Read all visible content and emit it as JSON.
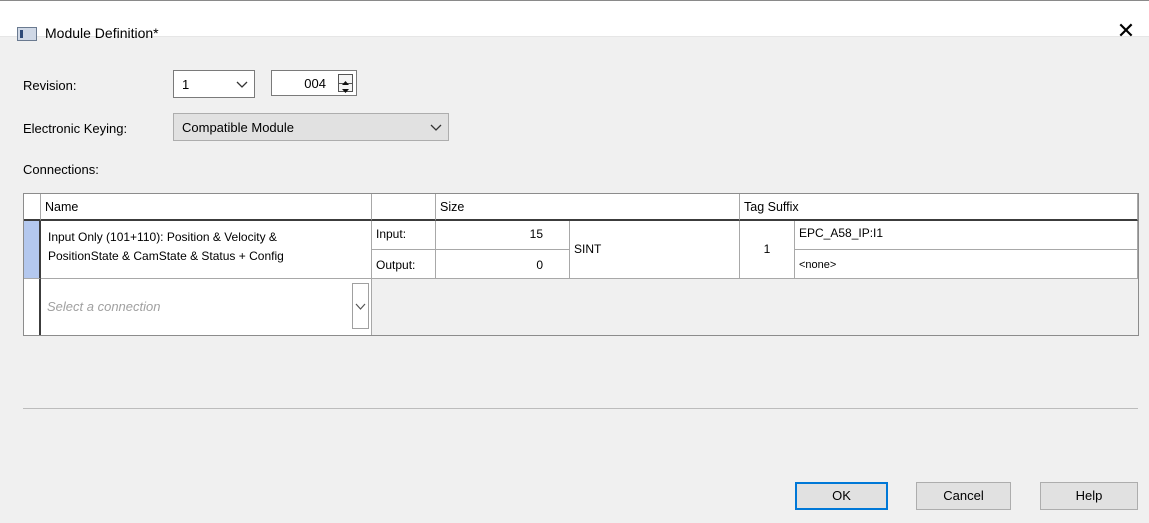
{
  "window": {
    "title": "Module Definition*"
  },
  "revision": {
    "label": "Revision:",
    "major": "1",
    "minor": "004"
  },
  "keying": {
    "label": "Electronic Keying:",
    "value": "Compatible Module"
  },
  "connections": {
    "label": "Connections:",
    "headers": {
      "name": "Name",
      "size": "Size",
      "tag_suffix": "Tag Suffix"
    },
    "rows": [
      {
        "name_line1": "Input Only (101+110): Position & Velocity &",
        "name_line2": "PositionState & CamState & Status + Config",
        "input_label": "Input:",
        "input_size": "15",
        "output_label": "Output:",
        "output_size": "0",
        "data_type": "SINT",
        "tag_index": "1",
        "input_tag": "EPC_A58_IP:I1",
        "output_tag": "<none>"
      }
    ],
    "new_row_placeholder": "Select a connection"
  },
  "buttons": {
    "ok": "OK",
    "cancel": "Cancel",
    "help": "Help"
  }
}
